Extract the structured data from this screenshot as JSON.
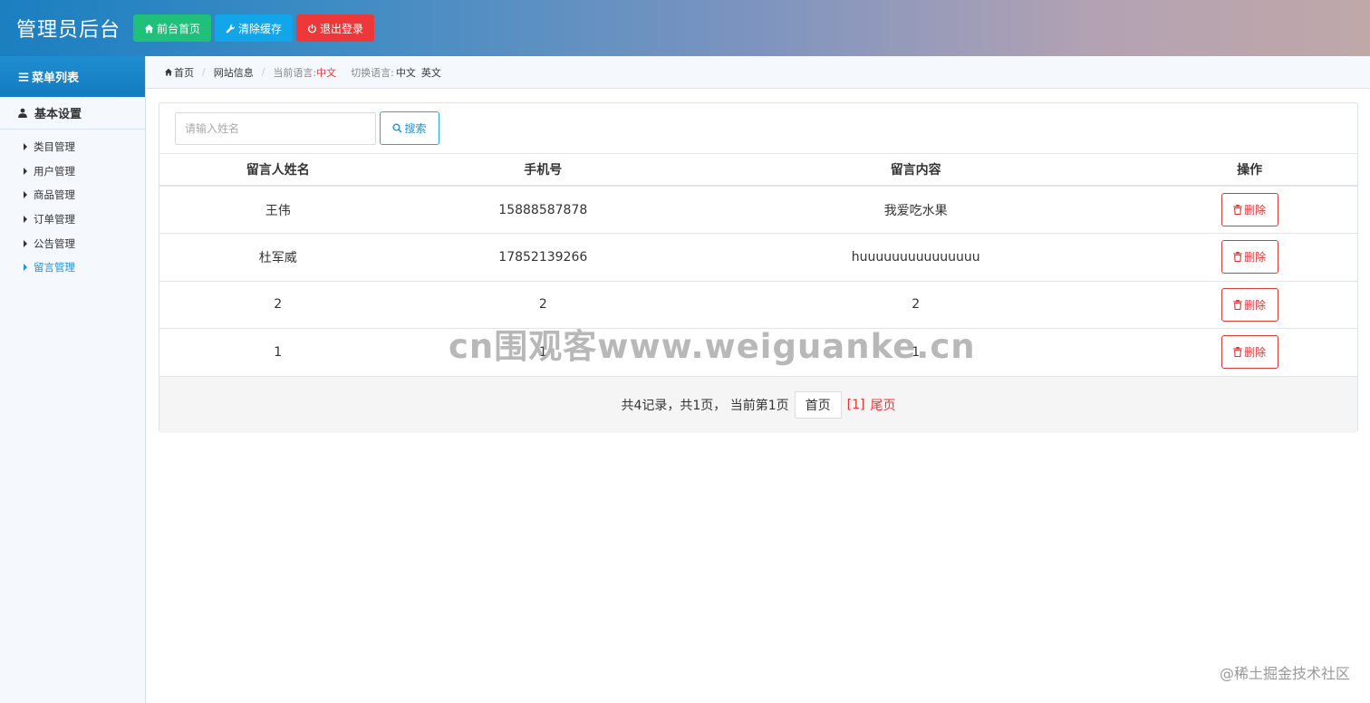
{
  "header": {
    "title": "管理员后台",
    "buttons": {
      "home": "前台首页",
      "clear_cache": "清除缓存",
      "logout": "退出登录"
    }
  },
  "sidebar": {
    "heading": "菜单列表",
    "group": "基本设置",
    "items": [
      {
        "label": "类目管理",
        "active": false
      },
      {
        "label": "用户管理",
        "active": false
      },
      {
        "label": "商品管理",
        "active": false
      },
      {
        "label": "订单管理",
        "active": false
      },
      {
        "label": "公告管理",
        "active": false
      },
      {
        "label": "留言管理",
        "active": true
      }
    ]
  },
  "breadcrumb": {
    "home": "首页",
    "current": "网站信息",
    "current_lang_label": "当前语言:",
    "current_lang": "中文",
    "switch_label": "切换语言:",
    "lang_zh": "中文",
    "lang_en": "英文"
  },
  "search": {
    "placeholder": "请输入姓名",
    "button": "搜索"
  },
  "table": {
    "headers": [
      "留言人姓名",
      "手机号",
      "留言内容",
      "操作"
    ],
    "delete_label": "删除",
    "rows": [
      [
        "王伟",
        "15888587878",
        "我爱吃水果"
      ],
      [
        "杜军威",
        "17852139266",
        "huuuuuuuuuuuuuuu"
      ],
      [
        "2",
        "2",
        "2"
      ],
      [
        "1",
        "1",
        "1"
      ]
    ]
  },
  "pager": {
    "summary": "共4记录，共1页， 当前第1页",
    "first": "首页",
    "current": "[1]",
    "last": "尾页"
  },
  "watermark": "cn围观客www.weiguanke.cn",
  "corner_mark": "@稀土掘金技术社区",
  "colors": {
    "accent": "#1a95e0",
    "danger": "#d93a3a",
    "success": "#1fc07a"
  }
}
